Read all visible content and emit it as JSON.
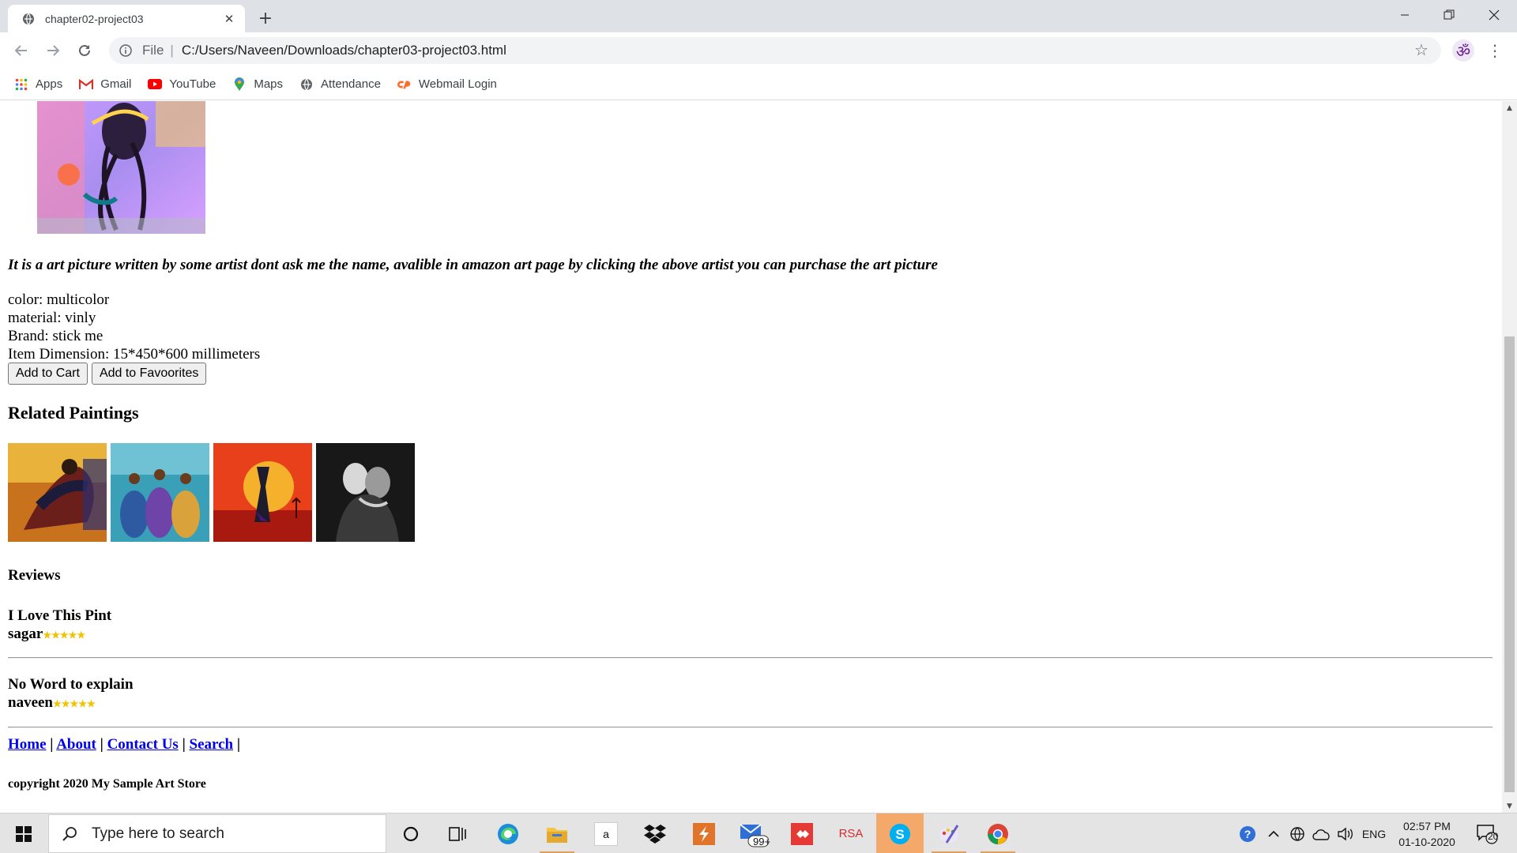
{
  "browser": {
    "tab_title": "chapter02-project03",
    "address_prefix": "File",
    "url": "C:/Users/Naveen/Downloads/chapter03-project03.html",
    "bookmarks": [
      {
        "label": "Apps",
        "icon": "apps-grid-icon"
      },
      {
        "label": "Gmail",
        "icon": "gmail-icon"
      },
      {
        "label": "YouTube",
        "icon": "youtube-icon"
      },
      {
        "label": "Maps",
        "icon": "maps-pin-icon"
      },
      {
        "label": "Attendance",
        "icon": "globe-icon"
      },
      {
        "label": "Webmail Login",
        "icon": "cpanel-icon"
      }
    ]
  },
  "page": {
    "description": "It is a art picture written by some artist dont ask me the name, avalible in amazon art page by clicking the above artist you can purchase the art picture",
    "specs": [
      "color: multicolor",
      "material: vinly",
      "Brand: stick me",
      "Item Dimension: 15*450*600 millimeters"
    ],
    "buttons": {
      "add_to_cart": "Add to Cart",
      "add_to_favourites": "Add to Favoorites"
    },
    "related_title": "Related Paintings",
    "reviews_title": "Reviews",
    "reviews": [
      {
        "title": "I Love This Pint",
        "author": "sagar",
        "stars": "★★★★★",
        "rating": 5
      },
      {
        "title": "No Word to explain",
        "author": "naveen",
        "stars": "★★★★★",
        "rating": 5
      }
    ],
    "footer_links": [
      "Home",
      "About",
      "Contact Us",
      "Search"
    ],
    "footer_sep": "|",
    "copyright": "copyright 2020 My Sample Art Store"
  },
  "taskbar": {
    "search_placeholder": "Type here to search",
    "mail_badge": "99+",
    "rsa_label": "RSA",
    "amazon_label": "a",
    "language": "ENG",
    "time": "02:57 PM",
    "date": "01-10-2020",
    "notification_count": "20"
  },
  "colors": {
    "link": "#0000ee",
    "star": "#f2c200",
    "taskbar_highlight": "#f4a86a"
  }
}
